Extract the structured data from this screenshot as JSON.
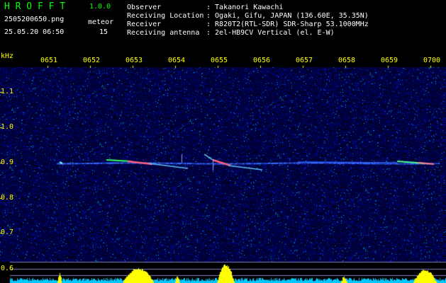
{
  "header": {
    "app_name": "H R O F F T",
    "version": "1.0.0",
    "filename": "2505200650.png",
    "meteor_label": "meteor",
    "meteor_count": "15",
    "datetime": "25.05.20 06:50",
    "observer_label": "Observer",
    "observer_value": ": Takanori Kawachi",
    "location_label": "Receiving Location",
    "location_value": ": Ogaki, Gifu, JAPAN (136.60E, 35.35N)",
    "receiver_label": "Receiver",
    "receiver_value": ": R820T2(RTL-SDR) SDR-Sharp 53.1000MHz",
    "antenna_label": "Receiving antenna",
    "antenna_value": ": 2el-HB9CV Vertical (el. E-W)"
  },
  "axis": {
    "unit": "kHz",
    "time_ticks": [
      "0651",
      "0652",
      "0653",
      "0654",
      "0655",
      "0656",
      "0657",
      "0658",
      "0659",
      "0700"
    ],
    "freq_ticks": [
      "1.1",
      "1.0",
      "0.9",
      "0.8",
      "0.7",
      "0.6"
    ]
  },
  "colors": {
    "header_green": "#00ff00",
    "axis_yellow": "#ffff00",
    "noise_blue": "#0a0a8c",
    "signal_cyan": "#00ffff",
    "meter_cyan": "#00c8ff"
  }
}
